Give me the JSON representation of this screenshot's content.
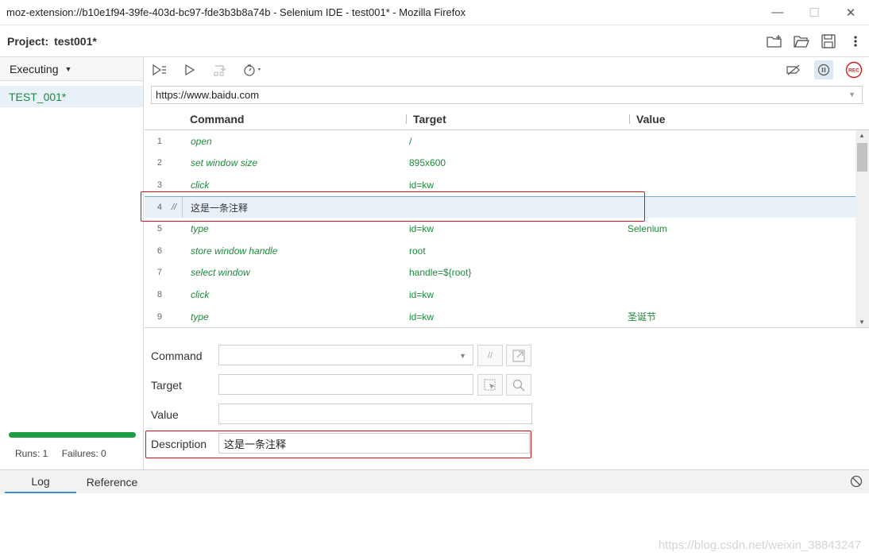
{
  "window": {
    "title": "moz-extension://b10e1f94-39fe-403d-bc97-fde3b3b8a74b - Selenium IDE - test001* - Mozilla Firefox",
    "minimize": "—",
    "maximize": "☐",
    "close": "✕"
  },
  "project": {
    "label": "Project:",
    "name": "test001*"
  },
  "sidebar": {
    "mode": "Executing",
    "tests": [
      "TEST_001*"
    ],
    "runs_label": "Runs: 1",
    "failures_label": "Failures: 0",
    "progress": 1.0,
    "progress_color": "#1f9d43"
  },
  "url": {
    "value": "https://www.baidu.com"
  },
  "table": {
    "headers": {
      "command": "Command",
      "target": "Target",
      "value": "Value"
    },
    "rows": [
      {
        "num": "1",
        "comment": "",
        "command": "open",
        "target": "/",
        "value": ""
      },
      {
        "num": "2",
        "comment": "",
        "command": "set window size",
        "target": "895x600",
        "value": ""
      },
      {
        "num": "3",
        "comment": "",
        "command": "click",
        "target": "id=kw",
        "value": ""
      },
      {
        "num": "4",
        "comment": "//",
        "command": "这是一条注释",
        "target": "",
        "value": ""
      },
      {
        "num": "5",
        "comment": "",
        "command": "type",
        "target": "id=kw",
        "value": "Selenium"
      },
      {
        "num": "6",
        "comment": "",
        "command": "store window handle",
        "target": "root",
        "value": ""
      },
      {
        "num": "7",
        "comment": "",
        "command": "select window",
        "target": "handle=${root}",
        "value": ""
      },
      {
        "num": "8",
        "comment": "",
        "command": "click",
        "target": "id=kw",
        "value": ""
      },
      {
        "num": "9",
        "comment": "",
        "command": "type",
        "target": "id=kw",
        "value": "圣诞节"
      }
    ]
  },
  "editor": {
    "command_label": "Command",
    "command_value": "",
    "comment_btn": "//",
    "target_label": "Target",
    "target_value": "",
    "value_label": "Value",
    "value_value": "",
    "description_label": "Description",
    "description_value": "这是一条注释"
  },
  "bottom": {
    "tabs": [
      "Log",
      "Reference"
    ]
  },
  "watermark": "https://blog.csdn.net/weixin_38843247",
  "colors": {
    "accent": "#3b8fd4",
    "command_green": "#1e8a3c",
    "highlight_red": "#dd1111",
    "selected_row": "#e9f1f8"
  }
}
